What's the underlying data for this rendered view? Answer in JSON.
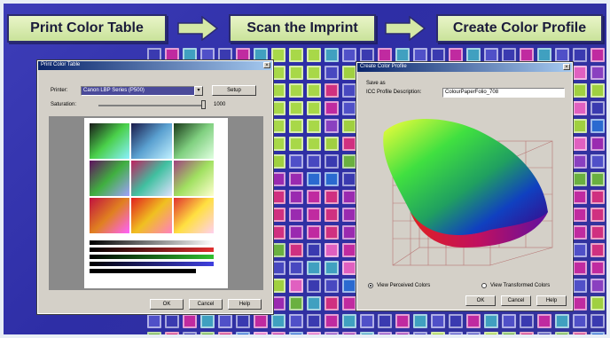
{
  "steps": {
    "print": "Print Color Table",
    "scan": "Scan the Imprint",
    "create": "Create Color Profile"
  },
  "print_dialog": {
    "title": "Print Color Table",
    "printer_label": "Printer:",
    "printer_value": "Canon LBP Series (P500)",
    "setup_button": "Setup",
    "saturation_label": "Saturation:",
    "saturation_value": "1000",
    "ok_button": "OK",
    "cancel_button": "Cancel",
    "help_button": "Help"
  },
  "profile_dialog": {
    "title": "Create Color Profile",
    "save_as_label": "Save as",
    "icc_label": "ICC Profile Description:",
    "icc_value": "ColourPaperFolio_708",
    "radio_perceived": "View Perceived Colors",
    "radio_transformed": "View Transformed Colors",
    "ok_button": "OK",
    "cancel_button": "Cancel",
    "help_button": "Help"
  },
  "colors": {
    "banner_fill": "#d6ebab",
    "background": "#3434a8",
    "arrow": "#c9e29a"
  }
}
